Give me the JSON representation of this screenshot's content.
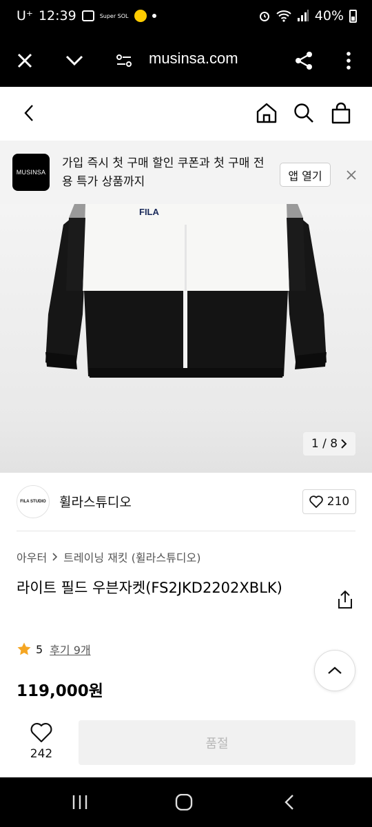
{
  "status_bar": {
    "carrier": "U⁺",
    "time": "12:39",
    "mini_label": "Super SOL",
    "battery": "40%"
  },
  "browser": {
    "url": "musinsa.com"
  },
  "app_banner": {
    "logo_text": "MUSINSA",
    "message": "가입 즉시 첫 구매 할인 쿠폰과 첫 구매 전용 특가 상품까지",
    "open_button": "앱 열기"
  },
  "image": {
    "logo": "FILA",
    "counter": "1 / 8"
  },
  "brand": {
    "avatar_text": "FILA STUDIO",
    "name": "휠라스튜디오",
    "likes": "210"
  },
  "product": {
    "breadcrumb": [
      "아우터",
      "트레이닝 재킷 (휠라스튜디오)"
    ],
    "title": "라이트 필드 우븐자켓(FS2JKD2202XBLK)",
    "rating": "5",
    "reviews": "후기 9개",
    "price": "119,000원"
  },
  "purchase_bar": {
    "wish_count": "242",
    "button_label": "품절"
  },
  "colors": {
    "star": "#f5a623",
    "soldout_text": "#b7b7b7"
  }
}
